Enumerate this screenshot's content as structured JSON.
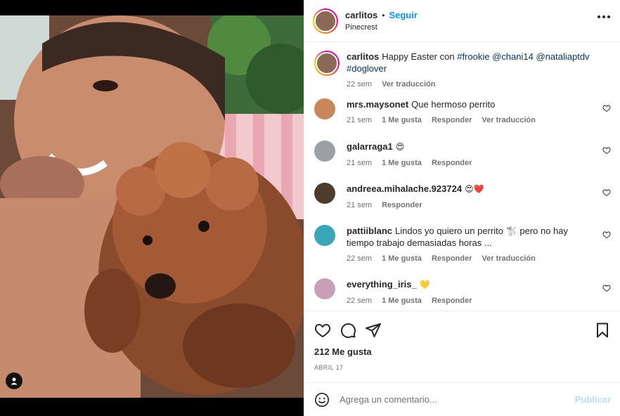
{
  "post": {
    "username": "carlitos",
    "follow_label": "Seguir",
    "location": "Pinecrest",
    "caption": {
      "username": "carlitos",
      "text": "Happy Easter con",
      "tags": [
        "#frookie",
        "@chani14",
        "@nataliaptdv",
        "#doglover"
      ],
      "time": "22 sem",
      "translate": "Ver traducción"
    }
  },
  "comments": [
    {
      "username": "mrs.maysonet",
      "text": "Que hermoso perrito",
      "time": "21 sem",
      "likes": "1 Me gusta",
      "reply": "Responder",
      "translate": "Ver traducción",
      "avatar_color": "#c8875a"
    },
    {
      "username": "galarraga1",
      "text": "😍",
      "time": "21 sem",
      "likes": "1 Me gusta",
      "reply": "Responder",
      "translate": "",
      "avatar_color": "#9aa0a6"
    },
    {
      "username": "andreea.mihalache.923724",
      "text": "😍❤️",
      "time": "21 sem",
      "likes": "",
      "reply": "Responder",
      "translate": "",
      "avatar_color": "#4d3b2c"
    },
    {
      "username": "pattiiblanc",
      "text": "Lindos yo quiero un perrito 🐩 pero no hay tiempo trabajo demasiadas horas ...",
      "time": "22 sem",
      "likes": "1 Me gusta",
      "reply": "Responder",
      "translate": "Ver traducción",
      "avatar_color": "#3aa6b9"
    },
    {
      "username": "everything_iris_",
      "text": "💛",
      "time": "22 sem",
      "likes": "1 Me gusta",
      "reply": "Responder",
      "translate": "",
      "avatar_color": "#c7a0b8"
    }
  ],
  "actions": {
    "likes_count": "212 Me gusta",
    "date": "ABRIL 17"
  },
  "add_comment": {
    "placeholder": "Agrega un comentario...",
    "publish_label": "Publicar"
  },
  "colors": {
    "link": "#0095f6",
    "hashtag": "#00376b",
    "muted": "#737373"
  }
}
